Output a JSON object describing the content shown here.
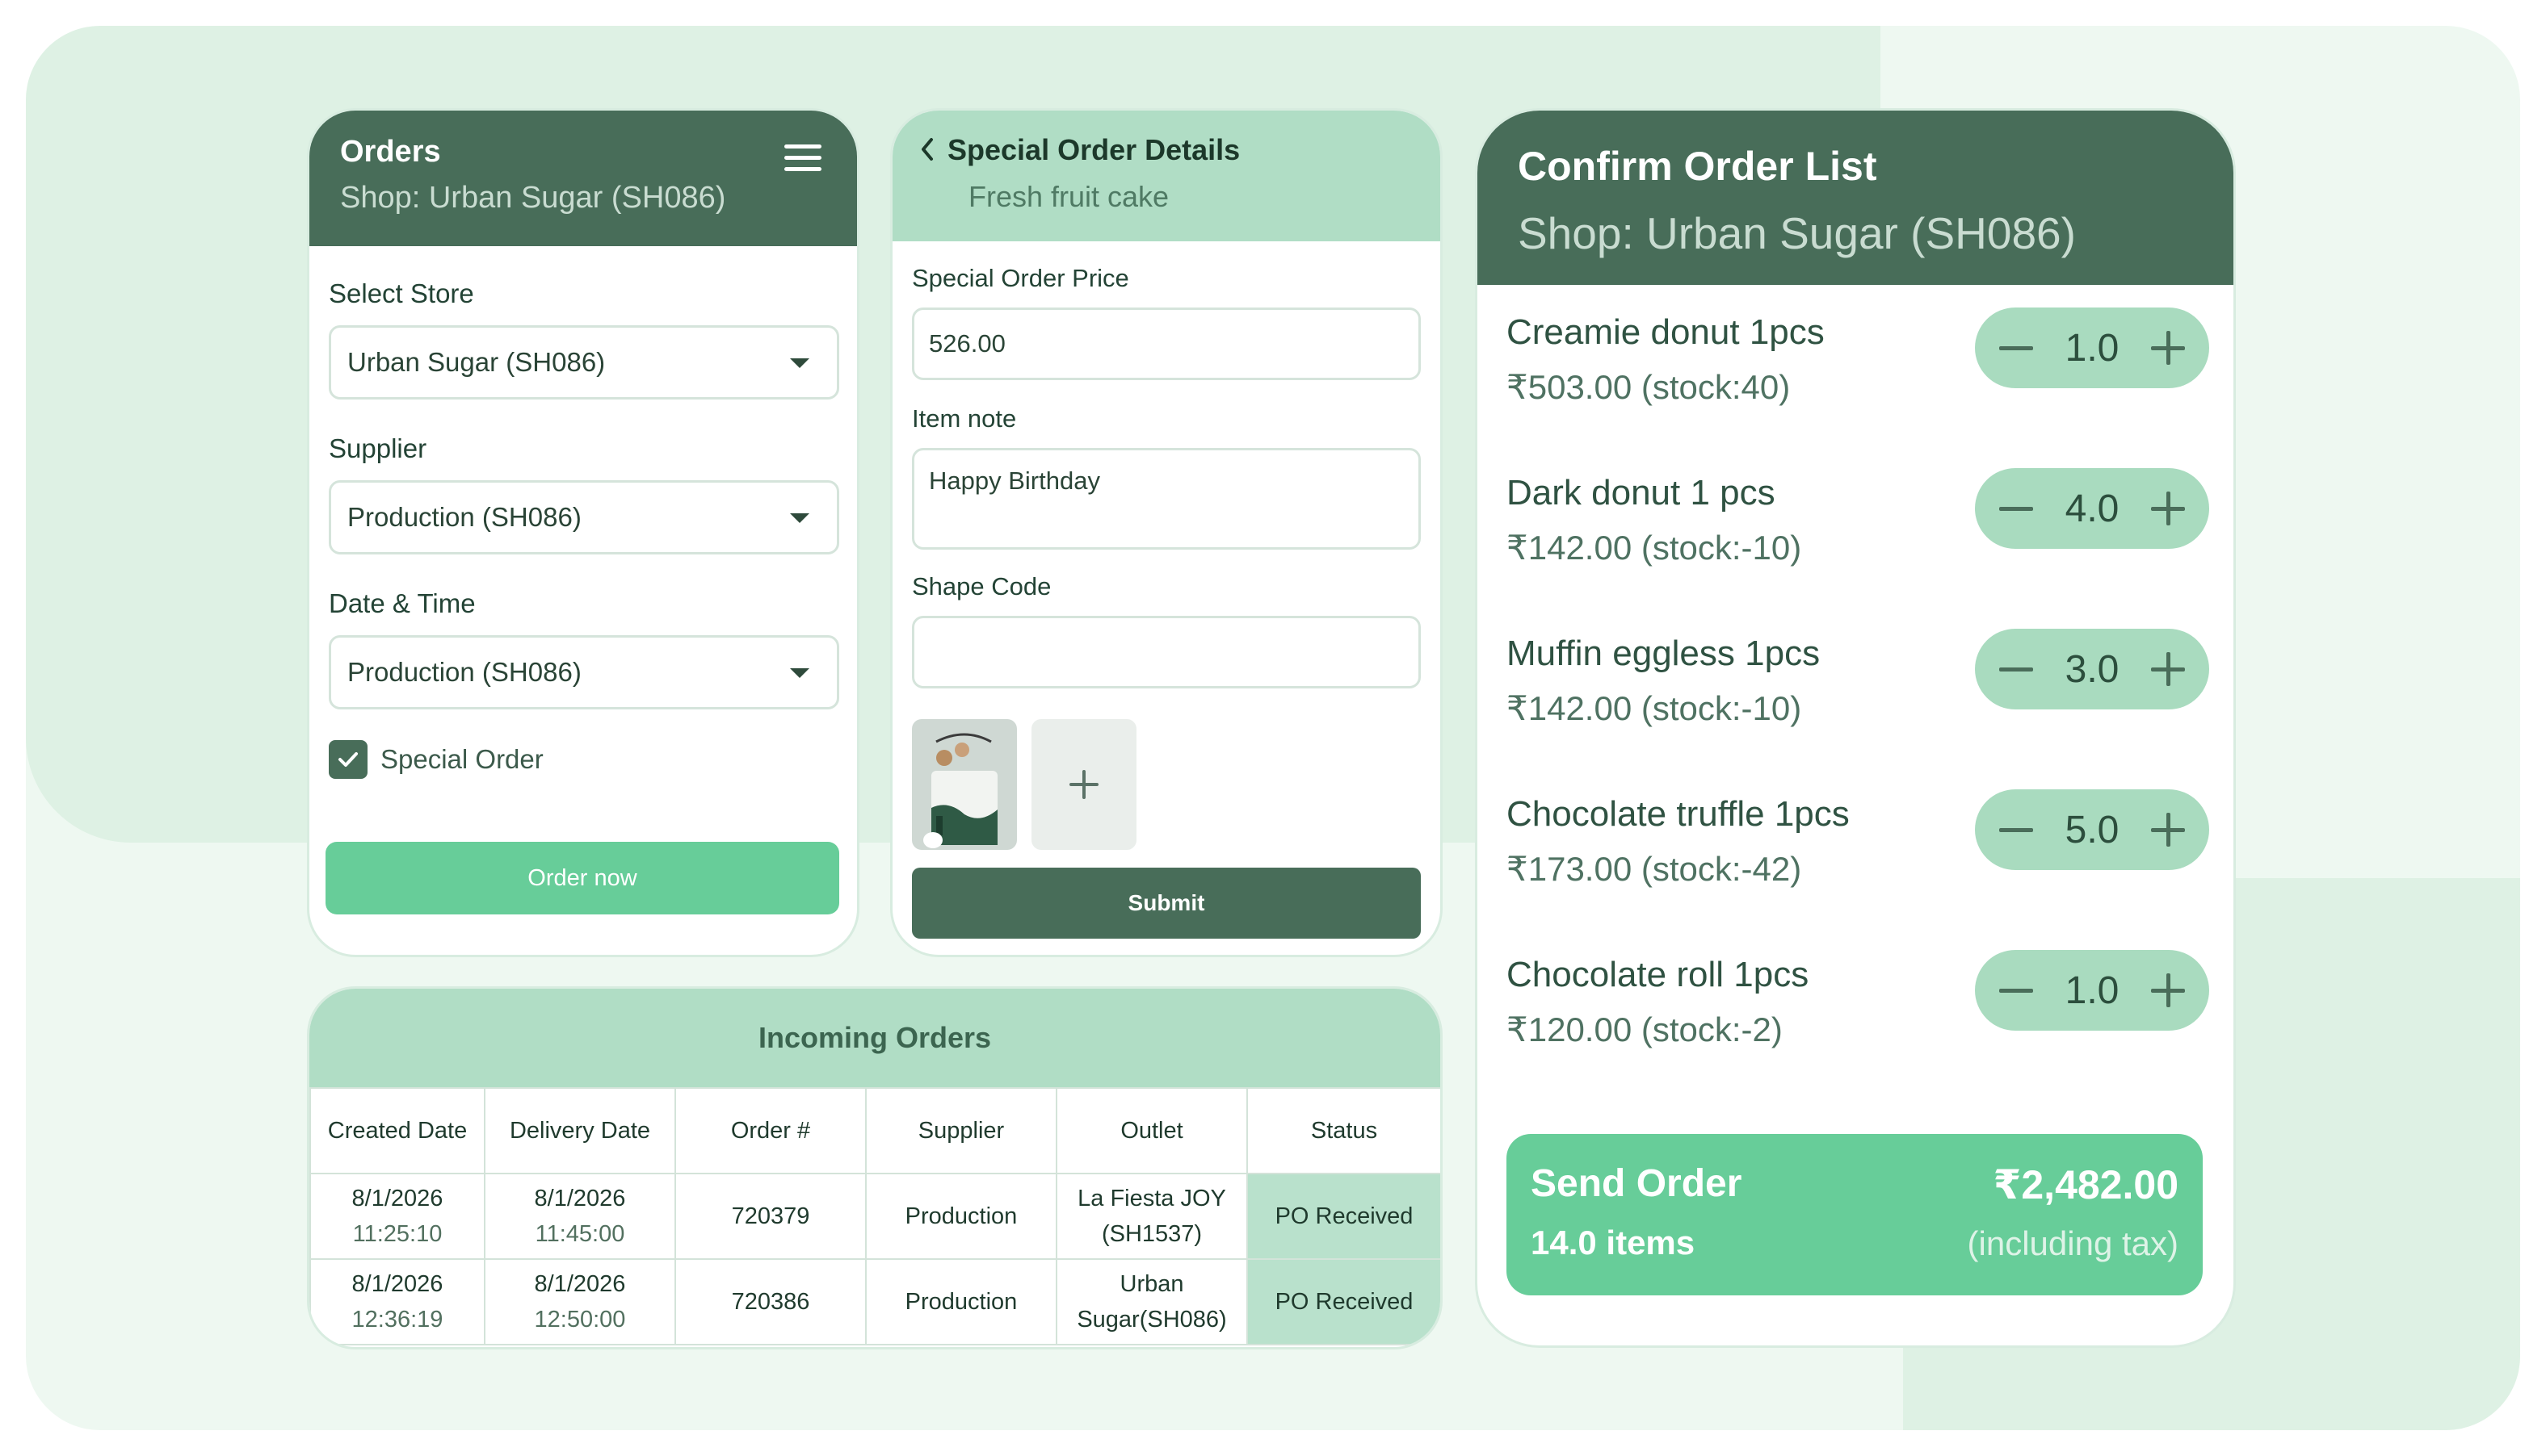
{
  "orders_card": {
    "title": "Orders",
    "shop": "Shop: Urban Sugar (SH086)",
    "store_label": "Select Store",
    "store_value": "Urban Sugar (SH086)",
    "supplier_label": "Supplier",
    "supplier_value": "Production (SH086)",
    "datetime_label": "Date & Time",
    "datetime_value": "Production (SH086)",
    "special_order_label": "Special Order",
    "special_order_checked": true,
    "order_button": "Order now"
  },
  "special_card": {
    "title": "Special Order Details",
    "subtitle": "Fresh fruit cake",
    "price_label": "Special Order Price",
    "price_value": "526.00",
    "note_label": "Item note",
    "note_value": "Happy Birthday",
    "shape_label": "Shape Code",
    "shape_value": "",
    "submit_button": "Submit"
  },
  "incoming": {
    "title": "Incoming Orders",
    "columns": [
      "Created Date",
      "Delivery Date",
      "Order #",
      "Supplier",
      "Outlet",
      "Status"
    ],
    "rows": [
      {
        "created_date": "8/1/2026",
        "created_time": "11:25:10",
        "delivery_date": "8/1/2026",
        "delivery_time": "11:45:00",
        "order_no": "720379",
        "supplier": "Production",
        "outlet_line1": "La Fiesta JOY",
        "outlet_line2": "(SH1537)",
        "status": "PO Received"
      },
      {
        "created_date": "8/1/2026",
        "created_time": "12:36:19",
        "delivery_date": "8/1/2026",
        "delivery_time": "12:50:00",
        "order_no": "720386",
        "supplier": "Production",
        "outlet_line1": "Urban",
        "outlet_line2": "Sugar(SH086)",
        "status": "PO Received"
      }
    ]
  },
  "confirm": {
    "title": "Confirm Order List",
    "shop": "Shop: Urban Sugar (SH086)",
    "items": [
      {
        "name": "Creamie donut 1pcs",
        "price": "₹503.00  (stock:40)",
        "qty": "1.0"
      },
      {
        "name": "Dark donut 1 pcs",
        "price": "₹142.00  (stock:-10)",
        "qty": "4.0"
      },
      {
        "name": "Muffin eggless 1pcs",
        "price": "₹142.00  (stock:-10)",
        "qty": "3.0"
      },
      {
        "name": "Chocolate truffle 1pcs",
        "price": "₹173.00  (stock:-42)",
        "qty": "5.0"
      },
      {
        "name": "Chocolate roll 1pcs",
        "price": "₹120.00  (stock:-2)",
        "qty": "1.0"
      }
    ],
    "send_label": "Send Order",
    "item_count": "14.0 items",
    "total": "₹2,482.00",
    "tax_note": "(including tax)"
  },
  "colors": {
    "dark_green": "#486d59",
    "accent_green": "#67cd99",
    "light_green": "#b0ddc5"
  },
  "icons": [
    "menu-icon",
    "chevron-down-icon",
    "check-icon",
    "back-chevron-icon",
    "plus-icon",
    "minus-icon"
  ]
}
